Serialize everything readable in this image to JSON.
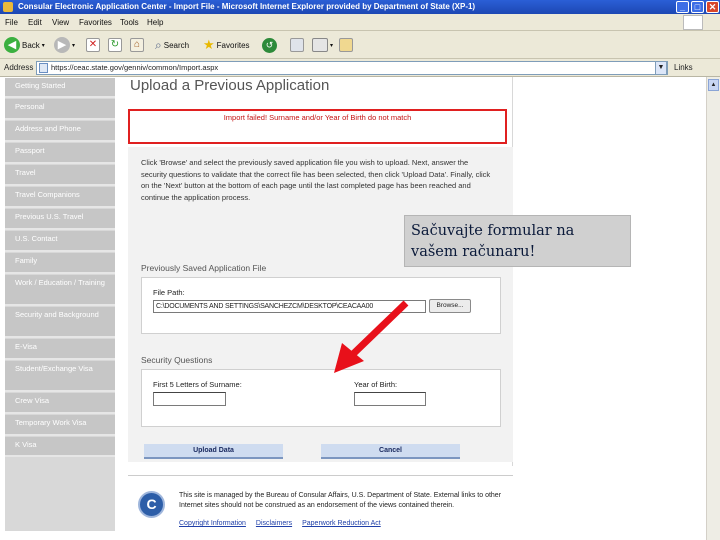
{
  "window": {
    "title": "Consular Electronic Application Center - Import File - Microsoft Internet Explorer provided by Department of State (XP-1)",
    "controls": [
      "_",
      "□",
      "✕"
    ]
  },
  "menu": [
    "File",
    "Edit",
    "View",
    "Favorites",
    "Tools",
    "Help"
  ],
  "toolbar": {
    "back_label": "Back",
    "search_label": "Search",
    "favorites_label": "Favorites"
  },
  "address": {
    "label": "Address",
    "url": "https://ceac.state.gov/genniv/common/Import.aspx",
    "links_label": "Links"
  },
  "sidebar": {
    "items": [
      "Getting Started",
      "Personal",
      "Address and Phone",
      "Passport",
      "Travel",
      "Travel Companions",
      "Previous U.S. Travel",
      "U.S. Contact",
      "Family",
      "Work / Education / Training",
      "Security and Background",
      "E-Visa",
      "Student/Exchange Visa",
      "Crew Visa",
      "Temporary Work Visa",
      "K Visa"
    ]
  },
  "main": {
    "title": "Upload a Previous Application",
    "error": "Import failed! Surname and/or Year of Birth do not match",
    "instructions": "Click 'Browse' and select the previously saved application file you wish to upload. Next, answer the security questions to validate that the correct file has been selected, then click 'Upload Data'. Finally, click on the 'Next' button at the bottom of each page until the last completed page has been reached and continue the application process.",
    "file_section": {
      "title": "Previously Saved Application File",
      "label": "File Path:",
      "value": "C:\\DOCUMENTS AND SETTINGS\\SANCHEZCM\\DESKTOP\\CEACAA00",
      "browse_label": "Browse..."
    },
    "security_section": {
      "title": "Security Questions",
      "surname_label": "First 5 Letters of Surname:",
      "yob_label": "Year of Birth:"
    },
    "upload_label": "Upload Data",
    "cancel_label": "Cancel"
  },
  "footer": {
    "text": "This site is managed by the Bureau of Consular Affairs, U.S. Department of State. External links to other Internet sites should not be construed as an endorsement of the views contained therein.",
    "links": [
      "Copyright Information",
      "Disclaimers",
      "Paperwork Reduction Act"
    ]
  },
  "callout": {
    "line1": "Sačuvajte formular na",
    "line2": "vašem računaru!"
  }
}
